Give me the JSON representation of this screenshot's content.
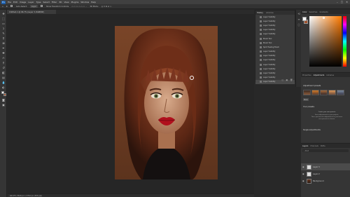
{
  "menu": {
    "logo": "Ps",
    "items": [
      "File",
      "Edit",
      "Image",
      "Layer",
      "Type",
      "Select",
      "Filter",
      "3D",
      "View",
      "Plugins",
      "Window",
      "Help"
    ]
  },
  "options": {
    "auto_select": "Auto-Select:",
    "layer": "Layer",
    "show_transform": "Show Transform Controls",
    "mode_3d": "3D Mode:"
  },
  "document": {
    "tab_title": "Untitled-1 @ 66.7% (Layer 3, RGB/8#)",
    "status": "66.67%   5616 px x 3744 px (300 ppi)"
  },
  "history": {
    "tabs": [
      "History",
      "Libraries"
    ],
    "active_tab": "History",
    "items": [
      "Layer Visibility",
      "Layer Visibility",
      "Layer Visibility",
      "Layer Visibility",
      "Layer Visibility",
      "Brush Tool",
      "Brush Tool",
      "Spot Healing Brush",
      "Layer Visibility",
      "Layer Visibility",
      "Layer Visibility",
      "Layer Visibility",
      "Layer Visibility",
      "Layer Visibility",
      "Layer Visibility",
      "Layer Visibility"
    ],
    "active_index": 15
  },
  "color_panel": {
    "tabs": [
      "Color",
      "Swatches",
      "Gradients"
    ],
    "active_tab": "Color",
    "fg_color": "#ffffff",
    "bg_color": "#a0522d"
  },
  "adjustments": {
    "tabs": [
      "Properties",
      "Adjustments",
      "Libraries"
    ],
    "active_tab": "Adjustments",
    "presets_title": "Adjustment presets",
    "more_label": "More",
    "your_presets": "Your presets",
    "presets_text_1": "Create your own presets",
    "presets_text_2": "Save adjustments to your project.",
    "presets_text_3": "Then, preview the adjustments as you hover",
    "presets_text_4": "over presets to choose.",
    "single_adjustments": "Single adjustments"
  },
  "layers": {
    "tabs": [
      "Layers",
      "Channels",
      "Paths"
    ],
    "active_tab": "Layers",
    "filter_label": "Kind",
    "rows": [
      {
        "name": "Layer 3",
        "kind": "blank"
      },
      {
        "name": "Layer 2",
        "kind": "blank"
      },
      {
        "name": "Background",
        "kind": "photo"
      }
    ],
    "selected": 0
  },
  "colors": {
    "accent": "#1e5da8",
    "app_bg": "#282828",
    "panel_bg": "#353535",
    "artboard_bg": "#7a4528"
  }
}
